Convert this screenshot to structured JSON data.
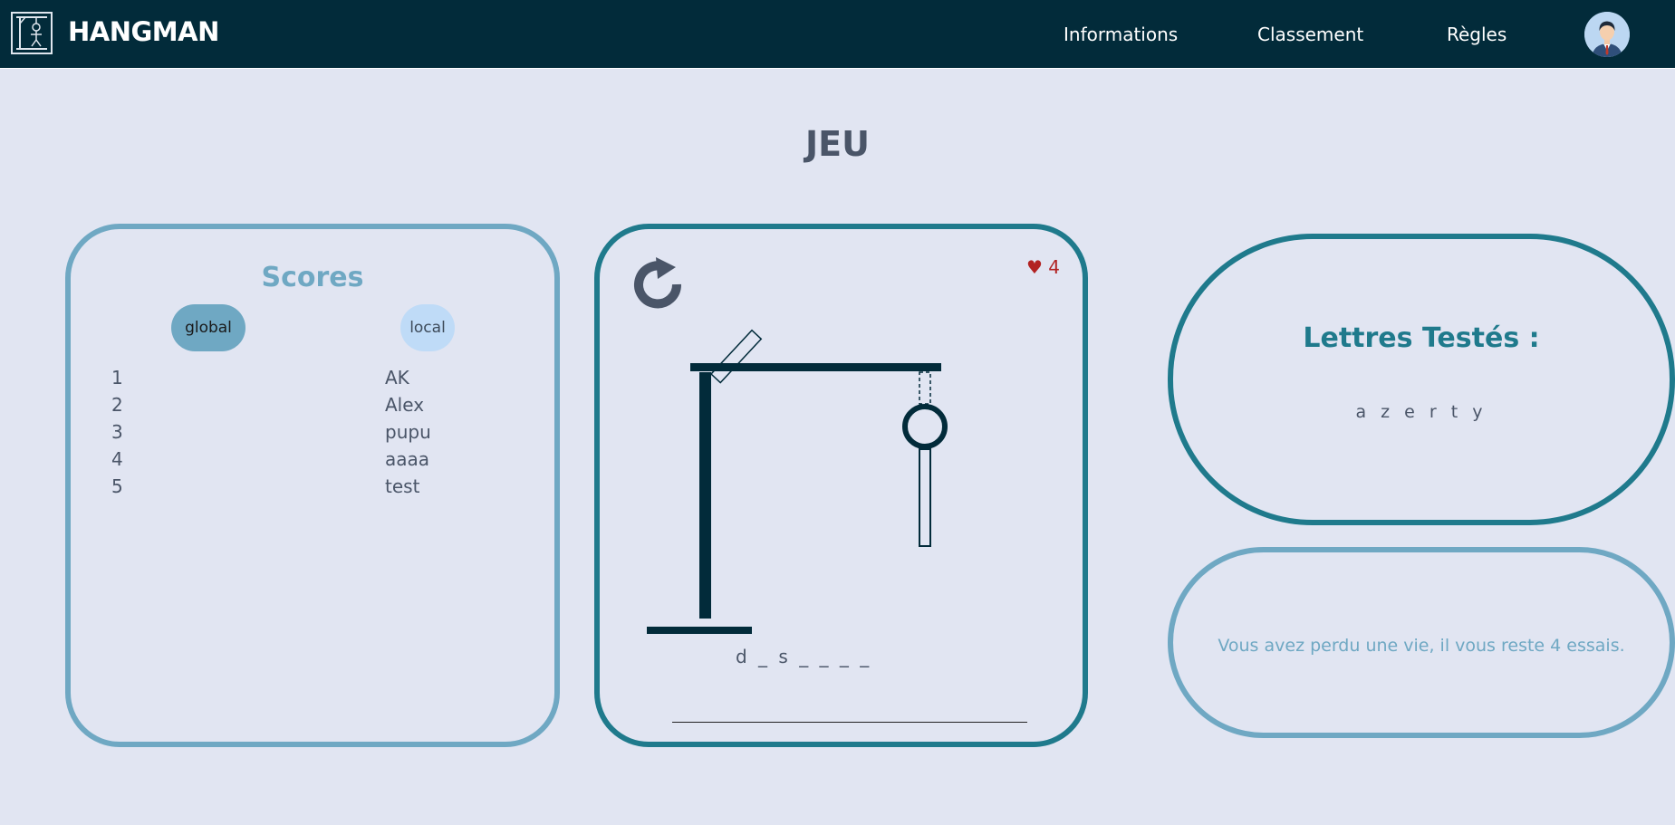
{
  "navbar": {
    "brand": "HANGMAN",
    "links": [
      "Informations",
      "Classement",
      "Règles"
    ]
  },
  "page": {
    "title": "JEU"
  },
  "scores": {
    "title": "Scores",
    "tabs": {
      "global": "global",
      "local": "local"
    },
    "rows": [
      {
        "rank": "1",
        "name": "AK"
      },
      {
        "rank": "2",
        "name": "Alex"
      },
      {
        "rank": "3",
        "name": "pupu"
      },
      {
        "rank": "4",
        "name": "aaaa"
      },
      {
        "rank": "5",
        "name": "test"
      }
    ]
  },
  "game": {
    "lives_icon": "heart-icon",
    "lives": "♥ 4",
    "word": "d _ s _ _ _ _",
    "input_value": ""
  },
  "letters": {
    "title": "Lettres Testés :",
    "tested": "a z e r t y"
  },
  "message": {
    "text": "Vous avez perdu une vie, il vous reste 4 essais."
  },
  "colors": {
    "navbar": "#022b3a",
    "background": "#e1e5f2",
    "primary": "#1f7a8c",
    "secondary": "#6fa8c3",
    "light": "#bfdbf7",
    "lives": "#b22222"
  }
}
